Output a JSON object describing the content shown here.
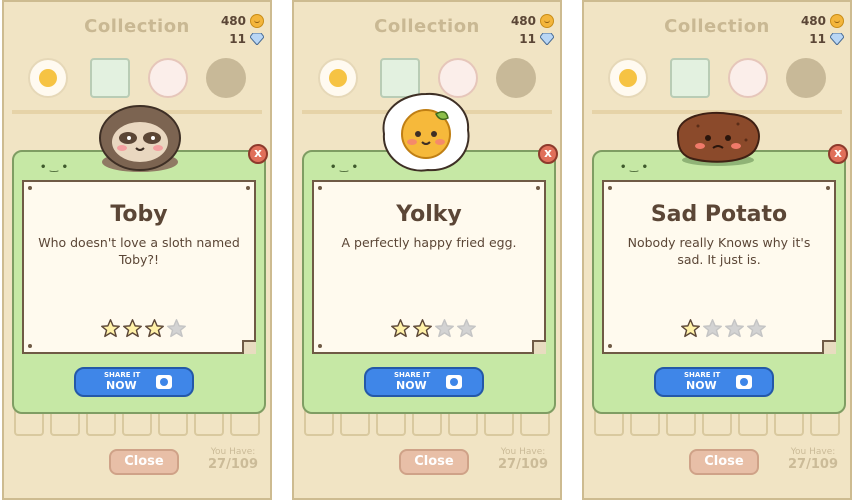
{
  "screens": [
    {
      "title": "Collection",
      "coins": "480",
      "gems": "11",
      "card_name": "Toby",
      "card_desc": "Who doesn't love a sloth named Toby?!",
      "stars_filled": 3,
      "stars_total": 4,
      "share_line1": "SHARE IT",
      "share_line2": "NOW",
      "close_label": "Close",
      "x_label": "x",
      "you_have_label": "You Have:",
      "you_have_count": "27/109",
      "card_face": "• ‿ •",
      "character_icon": "sloth-icon"
    },
    {
      "title": "Collection",
      "coins": "480",
      "gems": "11",
      "card_name": "Yolky",
      "card_desc": "A perfectly happy fried egg.",
      "stars_filled": 2,
      "stars_total": 4,
      "share_line1": "SHARE IT",
      "share_line2": "NOW",
      "close_label": "Close",
      "x_label": "x",
      "you_have_label": "You Have:",
      "you_have_count": "27/109",
      "card_face": "• ‿ •",
      "character_icon": "fried-egg-icon"
    },
    {
      "title": "Collection",
      "coins": "480",
      "gems": "11",
      "card_name": "Sad Potato",
      "card_desc": "Nobody really Knows why it's sad. It just is.",
      "stars_filled": 1,
      "stars_total": 4,
      "share_line1": "SHARE IT",
      "share_line2": "NOW",
      "close_label": "Close",
      "x_label": "x",
      "you_have_label": "You Have:",
      "you_have_count": "27/109",
      "card_face": "• ‿ •",
      "character_icon": "sad-potato-icon"
    }
  ],
  "colors": {
    "card_green": "#c6e8a5",
    "paper": "#fffaee",
    "text_brown": "#5b4636",
    "share_blue": "#3f86e8",
    "close_pink": "#e8bfa7",
    "star_filled": "#fff1a8",
    "star_empty": "#d3d3d3"
  }
}
